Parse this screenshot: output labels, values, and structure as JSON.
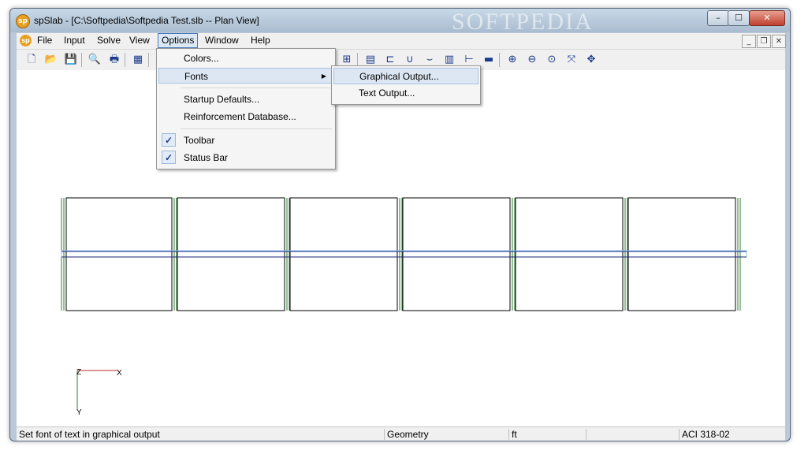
{
  "window": {
    "title": "spSlab - [C:\\Softpedia\\Softpedia Test.slb -- Plan View]",
    "app_icon_text": "sp",
    "min_symbol": "–",
    "max_symbol": "☐",
    "close_symbol": "✕",
    "watermark": "SOFTPEDIA"
  },
  "menubar": {
    "items": [
      "File",
      "Input",
      "Solve",
      "View",
      "Options",
      "Window",
      "Help"
    ],
    "active": "Options",
    "mdi_controls": [
      "_",
      "❐",
      "✕"
    ]
  },
  "toolbar": {
    "icons": [
      "new-icon",
      "open-icon",
      "save-icon",
      "print-preview-icon",
      "print-icon",
      "export-bmp-icon",
      "load-icon",
      "arrow-load-icon",
      "support-icon",
      "point-load-icon",
      "moment-icon",
      "view-front-icon",
      "view-top-icon",
      "view-side-icon",
      "view-iso-icon",
      "calculator-icon",
      "report-icon",
      "diagram-moment-icon",
      "diagram-shear-icon",
      "diagram-deflection-icon",
      "diagram-reinf-icon",
      "diagram-axes-icon",
      "diagram-section-icon",
      "zoom-in-icon",
      "zoom-out-icon",
      "zoom-window-icon",
      "zoom-extents-icon",
      "pan-icon"
    ],
    "glyphs": [
      "🗋",
      "📂",
      "💾",
      "🔍",
      "🖶",
      "▦",
      "⇣",
      "⇂",
      "⊓",
      "⊕",
      "⇔",
      "◧",
      "◨",
      "◩",
      "◪",
      "⊞",
      "▤",
      "⊏",
      "∪",
      "⌣",
      "▥",
      "⊢",
      "▬",
      "⊕",
      "⊖",
      "⊙",
      "⤧",
      "✥"
    ]
  },
  "options_menu": {
    "items": [
      {
        "label": "Colors...",
        "checked": false,
        "submenu": false
      },
      {
        "label": "Fonts",
        "checked": false,
        "submenu": true
      },
      {
        "label": "Startup Defaults...",
        "checked": false,
        "submenu": false
      },
      {
        "label": "Reinforcement Database...",
        "checked": false,
        "submenu": false
      },
      {
        "label": "Toolbar",
        "checked": true,
        "submenu": false
      },
      {
        "label": "Status Bar",
        "checked": true,
        "submenu": false
      }
    ],
    "check_glyph": "✓",
    "arrow_glyph": "▶"
  },
  "fonts_submenu": {
    "items": [
      "Graphical Output...",
      "Text Output..."
    ]
  },
  "axes": {
    "z": "Z",
    "x": "X",
    "y": "Y"
  },
  "statusbar": {
    "message": "Set font of text in graphical output",
    "mode": "Geometry",
    "units": "ft",
    "code": "ACI 318-02"
  },
  "colors": {
    "column_lines": "#2e7d32",
    "beam_line": "#1a237e",
    "beam_highlight": "#90caf9",
    "axis_red": "#c62828",
    "axis_green": "#2e7d32"
  }
}
